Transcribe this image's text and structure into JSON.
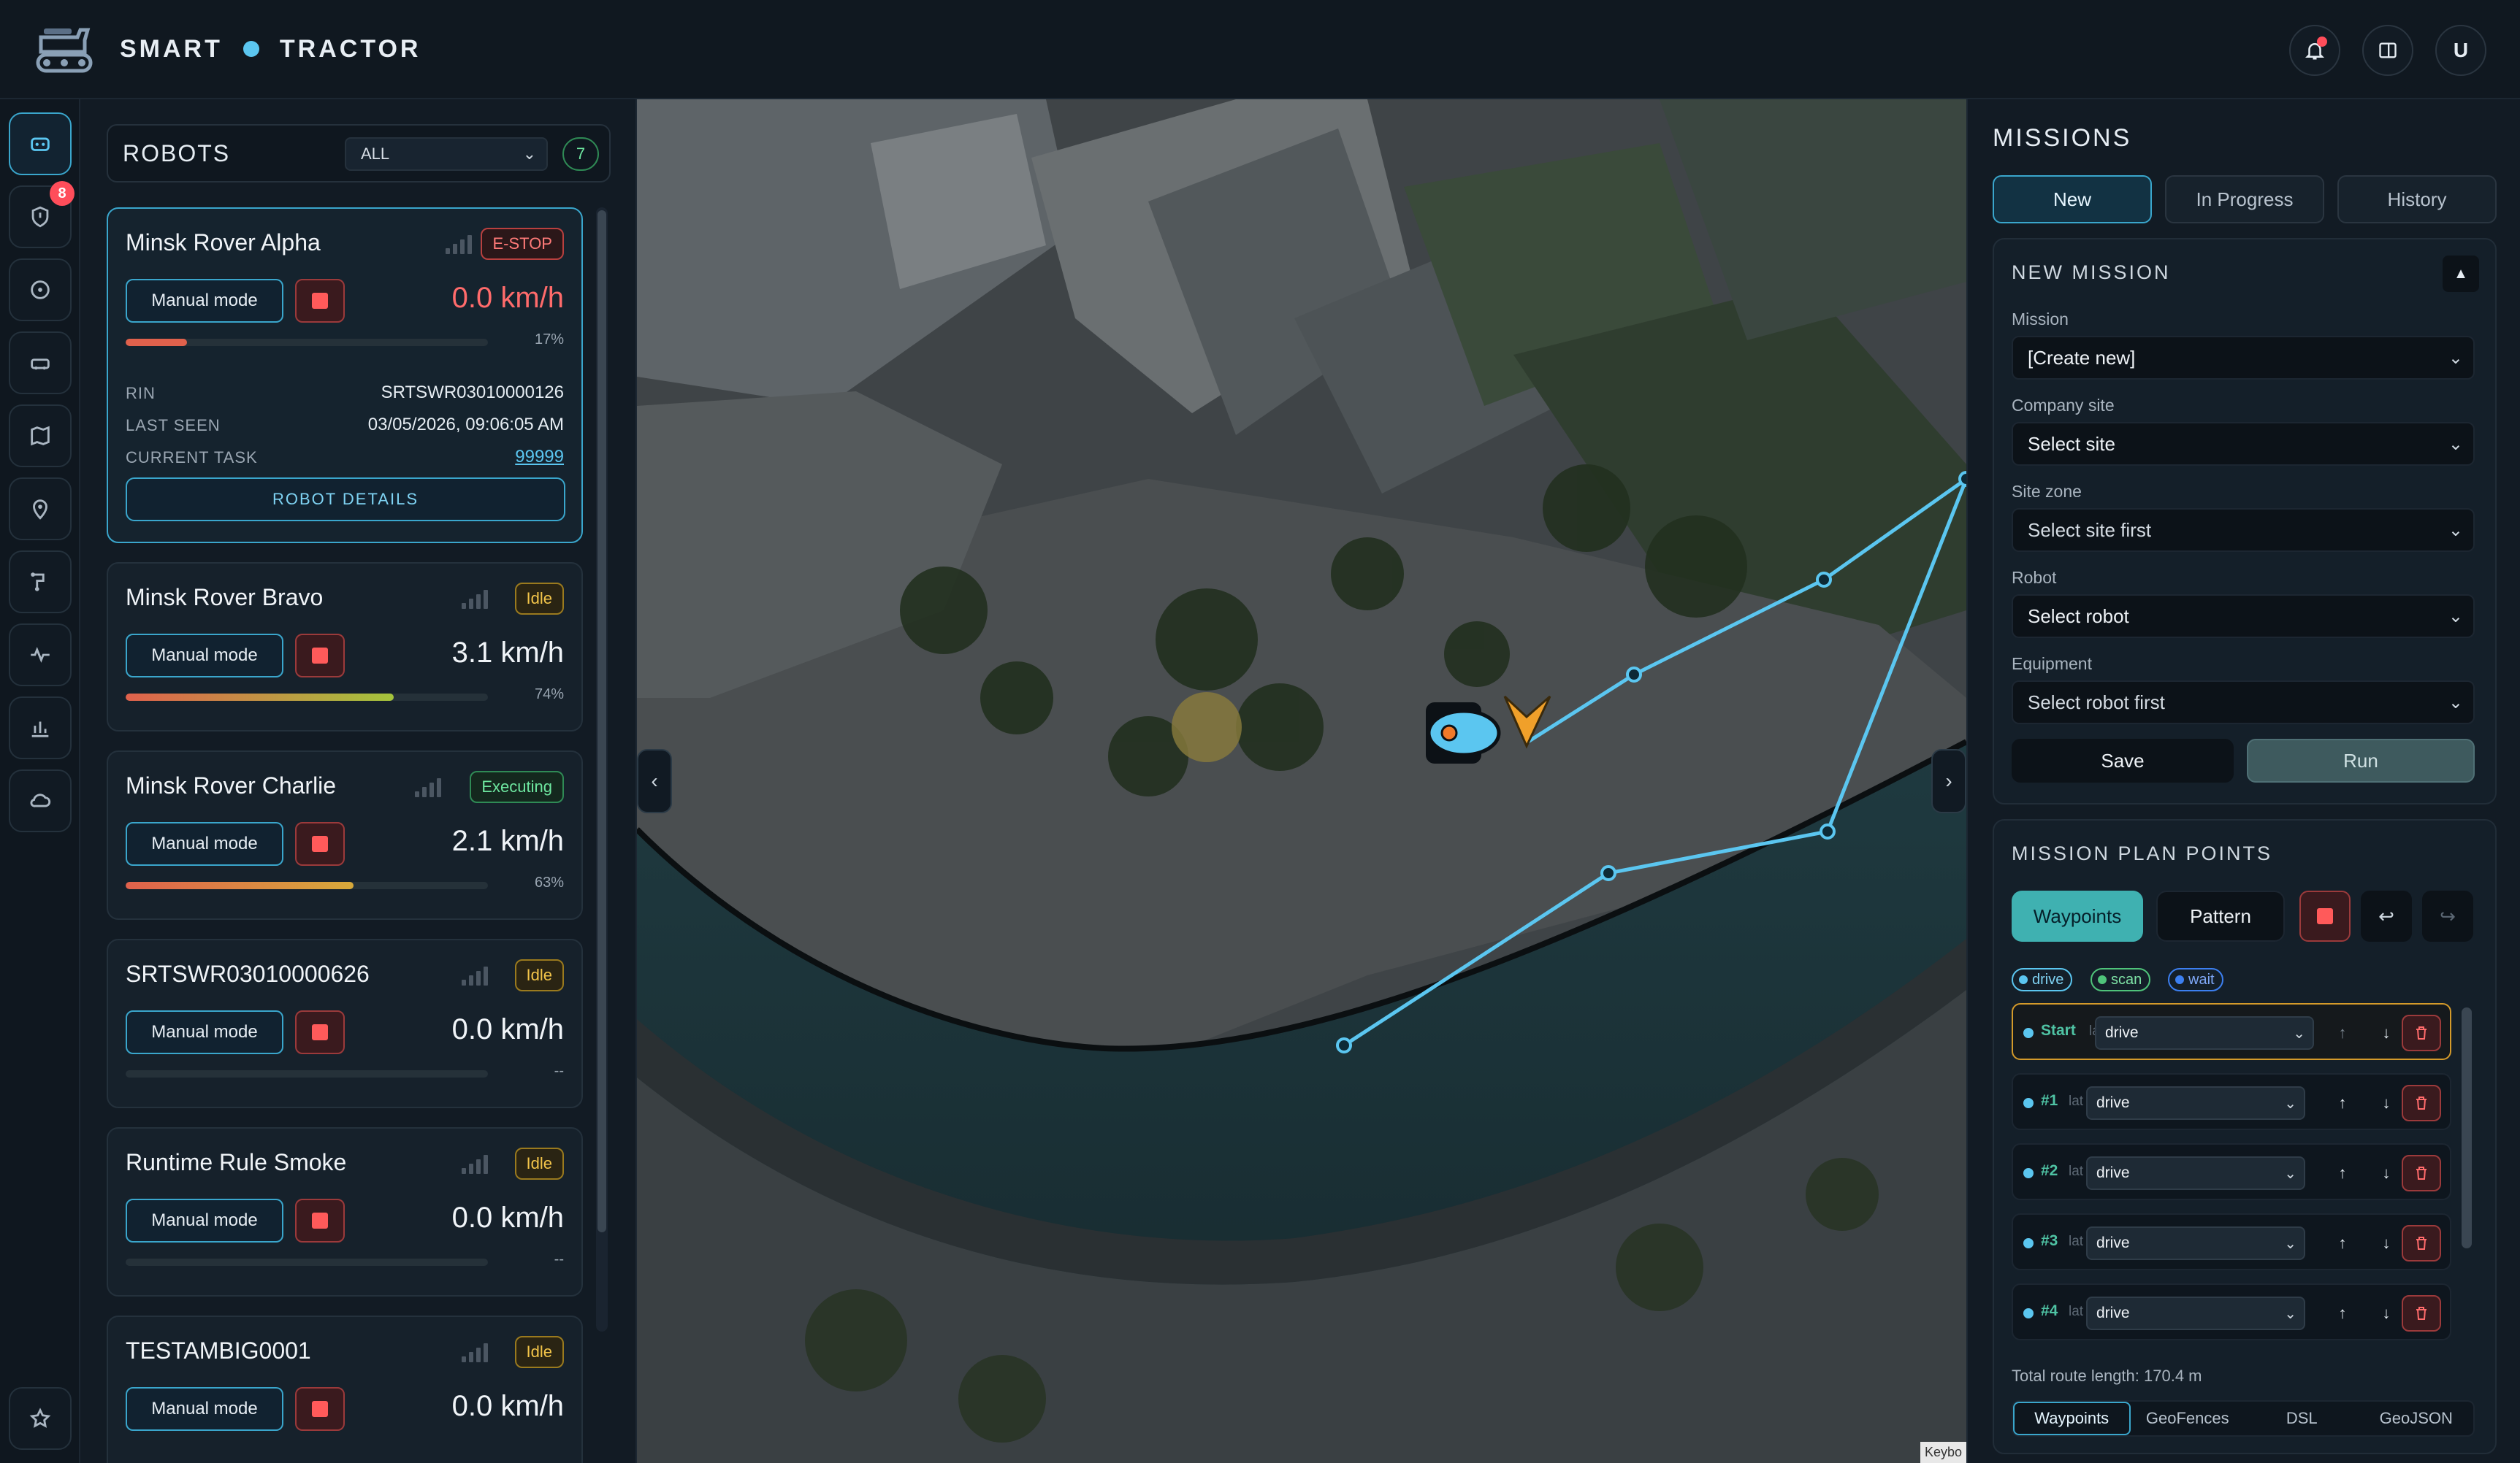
{
  "header": {
    "brand_left": "SMART",
    "brand_right": "TRACTOR",
    "user_initial": "U",
    "icons": [
      "tractor-logo-icon",
      "bell-icon",
      "layout-icon",
      "user-avatar"
    ]
  },
  "rail": {
    "badge_count": "8",
    "items": [
      "robot-icon",
      "shield-icon",
      "gauge-icon",
      "car-icon",
      "map-icon",
      "pin-icon",
      "route-icon",
      "activity-icon",
      "chart-icon",
      "cloud-icon",
      "star-icon"
    ]
  },
  "robots": {
    "title": "ROBOTS",
    "filter": "ALL",
    "count": "7",
    "manual_label": "Manual mode",
    "cards": [
      {
        "name": "Minsk Rover Alpha",
        "status": "E-STOP",
        "speed": "0.0 km/h",
        "progress_pct": "17%",
        "progress": 0.17,
        "bar_color": "#e0614c"
      },
      {
        "name": "Minsk Rover Bravo",
        "status": "Idle",
        "speed": "3.1 km/h",
        "progress_pct": "74%",
        "progress": 0.74,
        "bar_color": "#a4c43c"
      },
      {
        "name": "Minsk Rover Charlie",
        "status": "Executing",
        "speed": "2.1 km/h",
        "progress_pct": "63%",
        "progress": 0.63,
        "bar_color": "#d7a93a"
      },
      {
        "name": "SRTSWR03010000626",
        "status": "Idle",
        "speed": "0.0 km/h",
        "progress_pct": "--",
        "progress": 0
      },
      {
        "name": "Runtime Rule Smoke",
        "status": "Idle",
        "speed": "0.0 km/h",
        "progress_pct": "--",
        "progress": 0
      },
      {
        "name": "TESTAMBIG0001",
        "status": "Idle",
        "speed": "0.0 km/h",
        "progress_pct": "",
        "progress": 0
      }
    ],
    "details": {
      "rin_label": "RIN",
      "rin_value": "SRTSWR03010000126",
      "last_seen_label": "LAST SEEN",
      "last_seen_value": "03/05/2026, 09:06:05 AM",
      "task_label": "CURRENT TASK",
      "task_value": "99999",
      "details_button": "ROBOT DETAILS"
    }
  },
  "map": {
    "attribution": "Keybo"
  },
  "missions": {
    "title": "MISSIONS",
    "tabs": [
      "New",
      "In Progress",
      "History"
    ],
    "new_mission": {
      "title": "NEW MISSION",
      "fields": [
        {
          "label": "Mission",
          "value": "[Create new]"
        },
        {
          "label": "Company site",
          "value": "Select site"
        },
        {
          "label": "Site zone",
          "value": "Select site first"
        },
        {
          "label": "Robot",
          "value": "Select robot"
        },
        {
          "label": "Equipment",
          "value": "Select robot first"
        }
      ],
      "save": "Save",
      "run": "Run"
    },
    "plan": {
      "title": "MISSION PLAN POINTS",
      "tab_waypoints": "Waypoints",
      "tab_pattern": "Pattern",
      "chips": [
        {
          "label": "drive",
          "color": "#5bc6f0"
        },
        {
          "label": "scan",
          "color": "#4fc37a"
        },
        {
          "label": "wait",
          "color": "#3c7ff0"
        }
      ],
      "rows": [
        {
          "label": "Start",
          "lat": "la",
          "action": "drive"
        },
        {
          "label": "#1",
          "lat": "lat",
          "action": "drive"
        },
        {
          "label": "#2",
          "lat": "lat",
          "action": "drive"
        },
        {
          "label": "#3",
          "lat": "lat",
          "action": "drive"
        },
        {
          "label": "#4",
          "lat": "lat",
          "action": "drive"
        }
      ],
      "route_length": "Total route length: 170.4 m",
      "bottom_tabs": [
        "Waypoints",
        "GeoFences",
        "DSL",
        "GeoJSON"
      ]
    }
  },
  "colors": {
    "accent": "#3aa6cc",
    "route": "#5bc6f0",
    "danger": "#ff5a5a",
    "ok": "#6ee7a0",
    "warn": "#f3c54a"
  }
}
